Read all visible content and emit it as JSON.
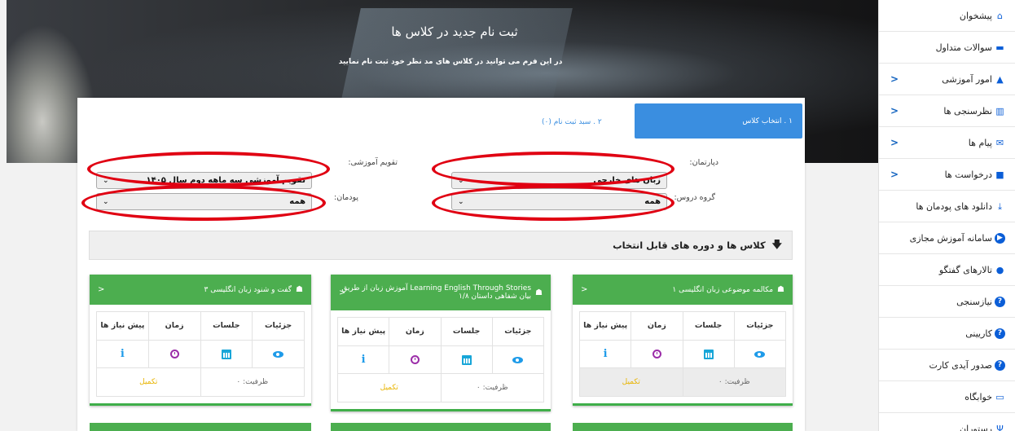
{
  "sidebar": {
    "items": [
      {
        "label": "پیشخوان",
        "icon": "home-icon",
        "arrow": false
      },
      {
        "label": "سوالات متداول",
        "icon": "chat-icon",
        "arrow": false
      },
      {
        "label": "امور آموزشی",
        "icon": "graduation-cap-icon",
        "arrow": true
      },
      {
        "label": "نظرسنجی ها",
        "icon": "bar-chart-icon",
        "arrow": true
      },
      {
        "label": "پیام ها",
        "icon": "envelope-icon",
        "arrow": true
      },
      {
        "label": "درخواست ها",
        "icon": "comment-icon",
        "arrow": true
      },
      {
        "label": "دانلود های پودمان ها",
        "icon": "download-icon",
        "arrow": false
      },
      {
        "label": "سامانه آموزش مجازی",
        "icon": "play-circle-icon",
        "arrow": false
      },
      {
        "label": "تالارهای گفتگو",
        "icon": "users-icon",
        "arrow": false
      },
      {
        "label": "نیازسنجی",
        "icon": "question-circle-icon",
        "arrow": false
      },
      {
        "label": "کاریینی",
        "icon": "question-circle-icon",
        "arrow": false
      },
      {
        "label": "صدور آیدی کارت",
        "icon": "question-circle-icon",
        "arrow": false
      },
      {
        "label": "خوابگاه",
        "icon": "bed-icon",
        "arrow": false
      },
      {
        "label": "رستوران",
        "icon": "cutlery-icon",
        "arrow": false
      }
    ],
    "arrow_glyph": "<"
  },
  "hero": {
    "title": "ثبت نام جدید در کلاس ها",
    "subtitle": "در این فرم می توانید در کلاس های مد نظر خود ثبت نام نمایید"
  },
  "steps": {
    "step1": "۱ . انتخاب کلاس",
    "step2": "۲ . سبد ثبت نام (۰)"
  },
  "filters": {
    "department_label": "دپارتمان:",
    "department_value": "زبان های خارجی",
    "calendar_label": "تقویم آموزشی:",
    "calendar_value": "تقویم آموزشی سه ماهه دوم سال ۱۴۰۵",
    "course_group_label": "گروه دروس:",
    "course_group_value": "همه",
    "module_label": "پودمان:",
    "module_value": "همه"
  },
  "available_title": "کلاس ها و دوره های قابل انتخاب",
  "table_headers": [
    "جزئیات",
    "جلسات",
    "زمان",
    "پیش نیاز ها"
  ],
  "cards": [
    {
      "title": "مکالمه موضوعی زبان انگلیسی ۱",
      "capacity": "ظرفیت: ۰",
      "status": "تکمیل",
      "grey": true
    },
    {
      "title": "Learning English Through Stories آموزش زبان از طریق بیان شفاهی داستان ۱/۸",
      "capacity": "ظرفیت: ۰",
      "status": "تکمیل",
      "grey": false
    },
    {
      "title": "گفت و شنود زبان انگلیسی ۳",
      "capacity": "ظرفیت: ۰",
      "status": "تکمیل",
      "grey": false
    }
  ],
  "colors": {
    "accent": "#4cae4f",
    "step_active": "#3a8ee0",
    "highlight_oval": "#e00012",
    "status_full": "#e8b400"
  }
}
